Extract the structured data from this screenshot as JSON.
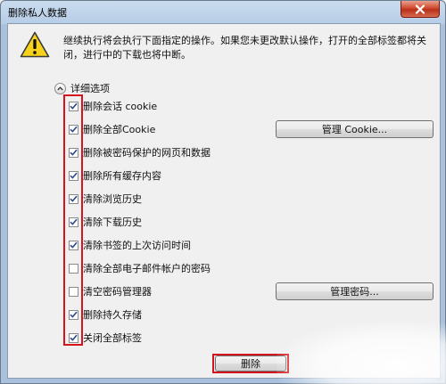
{
  "window": {
    "title": "删除私人数据",
    "close_icon": "close-icon"
  },
  "message": "继续执行将会执行下面指定的操作。如果您未更改默认操作，打开的全部标签都将关闭，进行中的下载也将中断。",
  "details": {
    "label": "详细选项",
    "icon": "chevron-up-icon"
  },
  "options": [
    {
      "label": "删除会话 cookie",
      "checked": true
    },
    {
      "label": "删除全部Cookie",
      "checked": true
    },
    {
      "label": "删除被密码保护的网页和数据",
      "checked": true
    },
    {
      "label": "删除所有缓存内容",
      "checked": true
    },
    {
      "label": "清除浏览历史",
      "checked": true
    },
    {
      "label": "清除下载历史",
      "checked": true
    },
    {
      "label": "清除书签的上次访问时间",
      "checked": true
    },
    {
      "label": "清除全部电子邮件帐户的密码",
      "checked": false
    },
    {
      "label": "清空密码管理器",
      "checked": false
    },
    {
      "label": "删除持久存储",
      "checked": true
    },
    {
      "label": "关闭全部标签",
      "checked": true
    }
  ],
  "buttons": {
    "manage_cookie": "管理 Cookie...",
    "manage_passwords": "管理密码...",
    "delete": "删除"
  },
  "colors": {
    "highlight": "#d6141e",
    "title_bar": "#b7cde6"
  }
}
